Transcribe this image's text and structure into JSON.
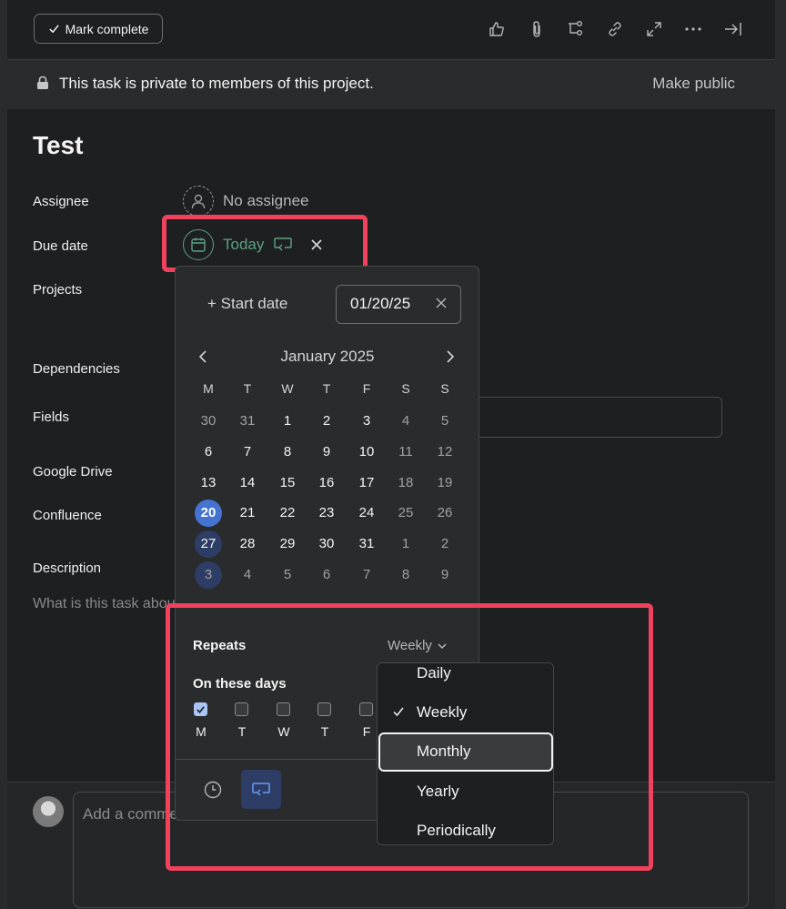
{
  "toolbar": {
    "mark_complete_label": "Mark complete",
    "icons": [
      "thumbs-up-icon",
      "paperclip-icon",
      "subtasks-icon",
      "link-icon",
      "expand-icon",
      "more-icon",
      "close-panel-icon"
    ]
  },
  "privacy": {
    "text": "This task is private to members of this project.",
    "action": "Make public"
  },
  "task": {
    "title": "Test",
    "labels": {
      "assignee": "Assignee",
      "due_date": "Due date",
      "projects": "Projects",
      "dependencies": "Dependencies",
      "fields": "Fields",
      "google_drive": "Google Drive",
      "confluence": "Confluence",
      "description": "Description"
    },
    "assignee_value": "No assignee",
    "due_value": "Today",
    "description_placeholder": "What is this task about?"
  },
  "date_picker": {
    "start_date_label": "+ Start date",
    "due_date_value": "01/20/25",
    "month_label": "January 2025",
    "weekdays": [
      "M",
      "T",
      "W",
      "T",
      "F",
      "S",
      "S"
    ],
    "weeks": [
      [
        "30",
        "31",
        "1",
        "2",
        "3",
        "4",
        "5"
      ],
      [
        "6",
        "7",
        "8",
        "9",
        "10",
        "11",
        "12"
      ],
      [
        "13",
        "14",
        "15",
        "16",
        "17",
        "18",
        "19"
      ],
      [
        "20",
        "21",
        "22",
        "23",
        "24",
        "25",
        "26"
      ],
      [
        "27",
        "28",
        "29",
        "30",
        "31",
        "1",
        "2"
      ],
      [
        "3",
        "4",
        "5",
        "6",
        "7",
        "8",
        "9"
      ]
    ],
    "selected_day": "20",
    "repeats_label": "Repeats",
    "repeats_value": "Weekly",
    "on_these_days_label": "On these days",
    "days": [
      {
        "label": "M",
        "checked": true
      },
      {
        "label": "T",
        "checked": false
      },
      {
        "label": "W",
        "checked": false
      },
      {
        "label": "T",
        "checked": false
      },
      {
        "label": "F",
        "checked": false
      }
    ]
  },
  "repeat_menu": {
    "options": [
      "Daily",
      "Weekly",
      "Monthly",
      "Yearly",
      "Periodically"
    ],
    "checked": "Weekly",
    "highlighted": "Monthly"
  },
  "comment": {
    "placeholder": "Add a comment"
  },
  "colors": {
    "accent_blue": "#4573d2",
    "due_green": "#5da283",
    "highlight_red": "#f0425c"
  }
}
